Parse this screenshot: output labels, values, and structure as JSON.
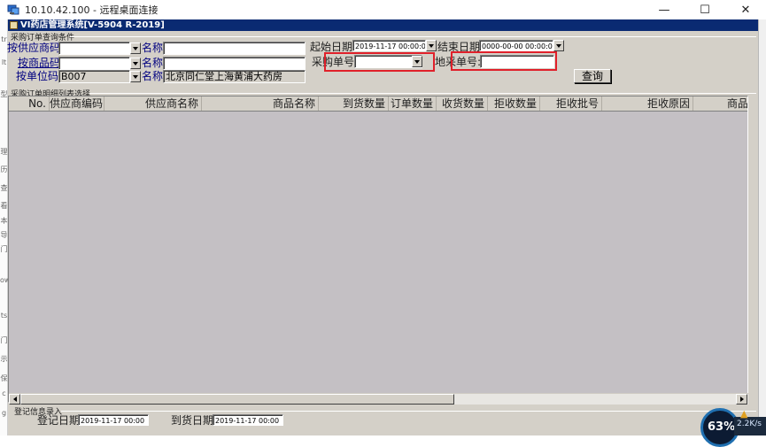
{
  "rdp": {
    "title": "10.10.42.100 - 远程桌面连接",
    "minimize": "—",
    "maximize": "☐",
    "close": "✕"
  },
  "left_strip_chars": [
    "tr",
    "lt",
    "型",
    "理",
    "历",
    "查",
    "看",
    "本",
    "导",
    "门",
    "ow",
    "ts",
    "门",
    "示",
    "保",
    "c",
    "g"
  ],
  "app": {
    "title": "VI药店管理系统[V-5904 R-2019]"
  },
  "query": {
    "group_label": "采购订单查询条件",
    "supplier_code_label": "按供应商码",
    "supplier_code_value": "",
    "supplier_name_label": "名称",
    "supplier_name_value": "",
    "product_code_label": "按商品码",
    "product_code_value": "",
    "product_name_label": "名称",
    "product_name_value": "",
    "unit_code_label": "按单位码",
    "unit_code_value": "B007",
    "unit_name_label": "名称",
    "unit_name_value": "北京同仁堂上海黄浦大药房",
    "start_date_label": "起始日期",
    "start_date_value": "2019-11-17 00:00:00",
    "end_date_label": "结束日期",
    "end_date_value": "0000-00-00 00:00:00",
    "po_number_label": "采购单号",
    "po_number_value": "",
    "origin_number_label": "地采单号:",
    "origin_number_value": "",
    "query_button": "查询"
  },
  "detail": {
    "group_label": "采购订单明细列表选择",
    "columns": [
      "No.",
      "供应商编码",
      "供应商名称",
      "商品名称",
      "到货数量",
      "订单数量",
      "收货数量",
      "拒收数量",
      "拒收批号",
      "拒收原因",
      "商品编"
    ]
  },
  "entry": {
    "group_label": "登记信息录入",
    "reg_date_label": "登记日期",
    "reg_date_value": "2019-11-17 00:00",
    "arrival_date_label": "到货日期",
    "arrival_date_value": "2019-11-17 00:00"
  },
  "net_widget": {
    "percent": "63%",
    "speed": "2.2K/s"
  },
  "colors": {
    "app_title_bg": "#0a2a72",
    "window_face": "#d4d0c8",
    "grid_bg": "#c4c0c4",
    "highlight_red": "#e0202a",
    "label_blue": "#000080"
  }
}
